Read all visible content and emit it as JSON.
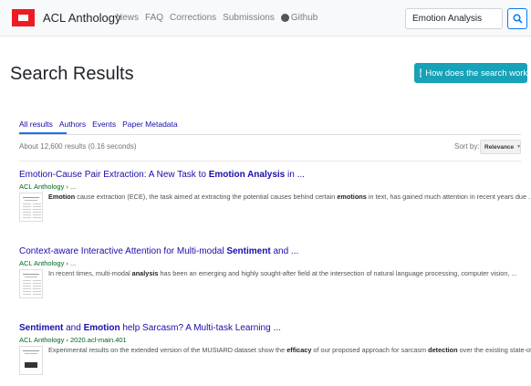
{
  "navbar": {
    "brand": "ACL Anthology",
    "links": [
      "News",
      "FAQ",
      "Corrections",
      "Submissions"
    ],
    "github": "Github",
    "search_value": "Emotion Analysis",
    "colors": {
      "logo": "#ed1c24",
      "accent": "#007bff"
    }
  },
  "header": {
    "title": "Search Results",
    "help_button": "How does the search work?"
  },
  "tabs": [
    "All results",
    "Authors",
    "Events",
    "Paper Metadata"
  ],
  "stats": "About 12,600 results (0.16 seconds)",
  "sort": {
    "label": "Sort by:",
    "value": "Relevance"
  },
  "results": [
    {
      "title_parts": [
        "Emotion-Cause Pair Extraction: A New Task to ",
        "Emotion Analysis",
        " in ..."
      ],
      "cite": "ACL Anthology › ...",
      "snippet_parts": [
        "Emotion",
        " cause extraction (ECE), the task aimed at extracting the potential causes behind certain ",
        "emotions",
        " in text, has gained much attention in recent years due ..."
      ]
    },
    {
      "title_parts": [
        "Context-aware Interactive Attention for Multi-modal ",
        "Sentiment",
        " and ..."
      ],
      "cite": "ACL Anthology › ...",
      "snippet_parts": [
        "In recent times, multi-modal ",
        "analysis",
        " has been an emerging and highly sought-after field at the intersection of natural language processing, computer vision, ..."
      ]
    },
    {
      "title_parts": [
        "Sentiment",
        " and ",
        "Emotion",
        " help Sarcasm? A Multi-task Learning ..."
      ],
      "cite": "ACL Anthology › 2020.acl-main.401",
      "snippet_parts": [
        "Experimental results on the extended version of the MUStARD dataset show the ",
        "efficacy",
        " of our proposed approach for sarcasm ",
        "detection",
        " over the existing state-of- ..."
      ]
    }
  ]
}
